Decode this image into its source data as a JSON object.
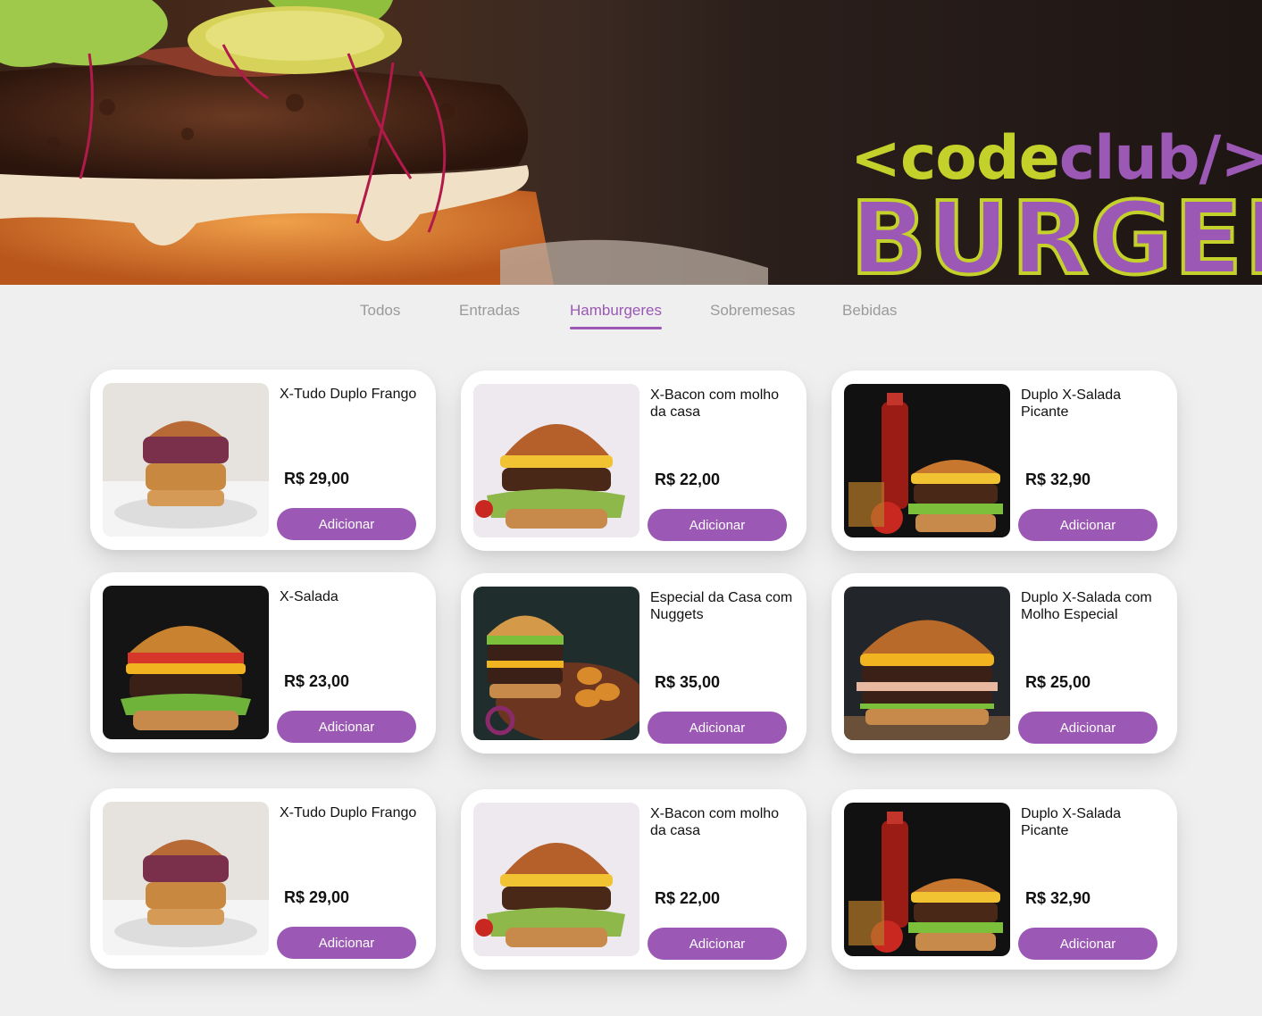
{
  "brand": {
    "line1_part1": "<code",
    "line1_part2": "club/>",
    "line2": "BURGER"
  },
  "tabs": [
    {
      "label": "Todos"
    },
    {
      "label": "Entradas"
    },
    {
      "label": "Hamburgeres"
    },
    {
      "label": "Sobremesas"
    },
    {
      "label": "Bebidas"
    }
  ],
  "active_tab": "Hamburgeres",
  "products": [
    {
      "name": "X-Tudo Duplo Frango",
      "price": "R$ 29,00",
      "button": "Adicionar"
    },
    {
      "name": "X-Bacon com molho da casa",
      "price": "R$ 22,00",
      "button": "Adicionar"
    },
    {
      "name": "Duplo X-Salada Picante",
      "price": "R$ 32,90",
      "button": "Adicionar"
    },
    {
      "name": "X-Salada",
      "price": "R$ 23,00",
      "button": "Adicionar"
    },
    {
      "name": "Especial da Casa com Nuggets",
      "price": "R$ 35,00",
      "button": "Adicionar"
    },
    {
      "name": "Duplo X-Salada com Molho Especial",
      "price": "R$ 25,00",
      "button": "Adicionar"
    },
    {
      "name": "X-Tudo Duplo Frango",
      "price": "R$ 29,00",
      "button": "Adicionar"
    },
    {
      "name": "X-Bacon com molho da casa",
      "price": "R$ 22,00",
      "button": "Adicionar"
    },
    {
      "name": "Duplo X-Salada Picante",
      "price": "R$ 32,90",
      "button": "Adicionar"
    }
  ],
  "colors": {
    "accent": "#9b58b4",
    "logo_green": "#c5d12b",
    "background": "#efefef",
    "tab_inactive": "#9a9a9a"
  }
}
